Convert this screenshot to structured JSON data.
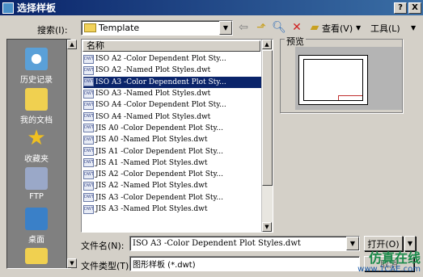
{
  "window": {
    "title": "选择样板",
    "help_label": "?",
    "close_label": "X"
  },
  "look_in": {
    "label": "搜索(I):",
    "value": "Template"
  },
  "toolbar": {
    "view_label": "查看(V)",
    "tools_label": "工具(L)"
  },
  "places": [
    {
      "label": "历史记录",
      "icon": "history-icon",
      "color": "#5aa0d8"
    },
    {
      "label": "我的文档",
      "icon": "documents-folder-icon",
      "color": "#f0d050"
    },
    {
      "label": "收藏夹",
      "icon": "favorites-star-icon",
      "color": "#f0c020"
    },
    {
      "label": "FTP",
      "icon": "ftp-icon",
      "color": "#9aa8c8"
    },
    {
      "label": "桌面",
      "icon": "desktop-icon",
      "color": "#3a80c8"
    }
  ],
  "file_list": {
    "column_header": "名称",
    "file_icon_text": "DWT",
    "rows": [
      {
        "name": "ISO A2 -Color Dependent Plot Sty...",
        "selected": false
      },
      {
        "name": "ISO A2 -Named Plot Styles.dwt",
        "selected": false
      },
      {
        "name": "ISO A3 -Color Dependent Plot Sty...",
        "selected": true
      },
      {
        "name": "ISO A3 -Named Plot Styles.dwt",
        "selected": false
      },
      {
        "name": "ISO A4 -Color Dependent Plot Sty...",
        "selected": false
      },
      {
        "name": "ISO A4 -Named Plot Styles.dwt",
        "selected": false
      },
      {
        "name": "JIS A0 -Color Dependent Plot Sty...",
        "selected": false
      },
      {
        "name": "JIS A0 -Named Plot Styles.dwt",
        "selected": false
      },
      {
        "name": "JIS A1 -Color Dependent Plot Sty...",
        "selected": false
      },
      {
        "name": "JIS A1 -Named Plot Styles.dwt",
        "selected": false
      },
      {
        "name": "JIS A2 -Color Dependent Plot Sty...",
        "selected": false
      },
      {
        "name": "JIS A2 -Named Plot Styles.dwt",
        "selected": false
      },
      {
        "name": "JIS A3 -Color Dependent Plot Sty...",
        "selected": false
      },
      {
        "name": "JIS A3 -Named Plot Styles.dwt",
        "selected": false
      }
    ]
  },
  "preview": {
    "label": "预览"
  },
  "filename": {
    "label": "文件名(N):",
    "value": "ISO A3 -Color Dependent Plot Styles.dwt"
  },
  "filetype": {
    "label": "文件类型(T):",
    "value": "图形样板 (*.dwt)"
  },
  "buttons": {
    "open_label": "打开(O)",
    "cancel_label": "取消"
  },
  "watermark": {
    "text_cn": "仿真在线",
    "url": "www.1CAE.com"
  }
}
